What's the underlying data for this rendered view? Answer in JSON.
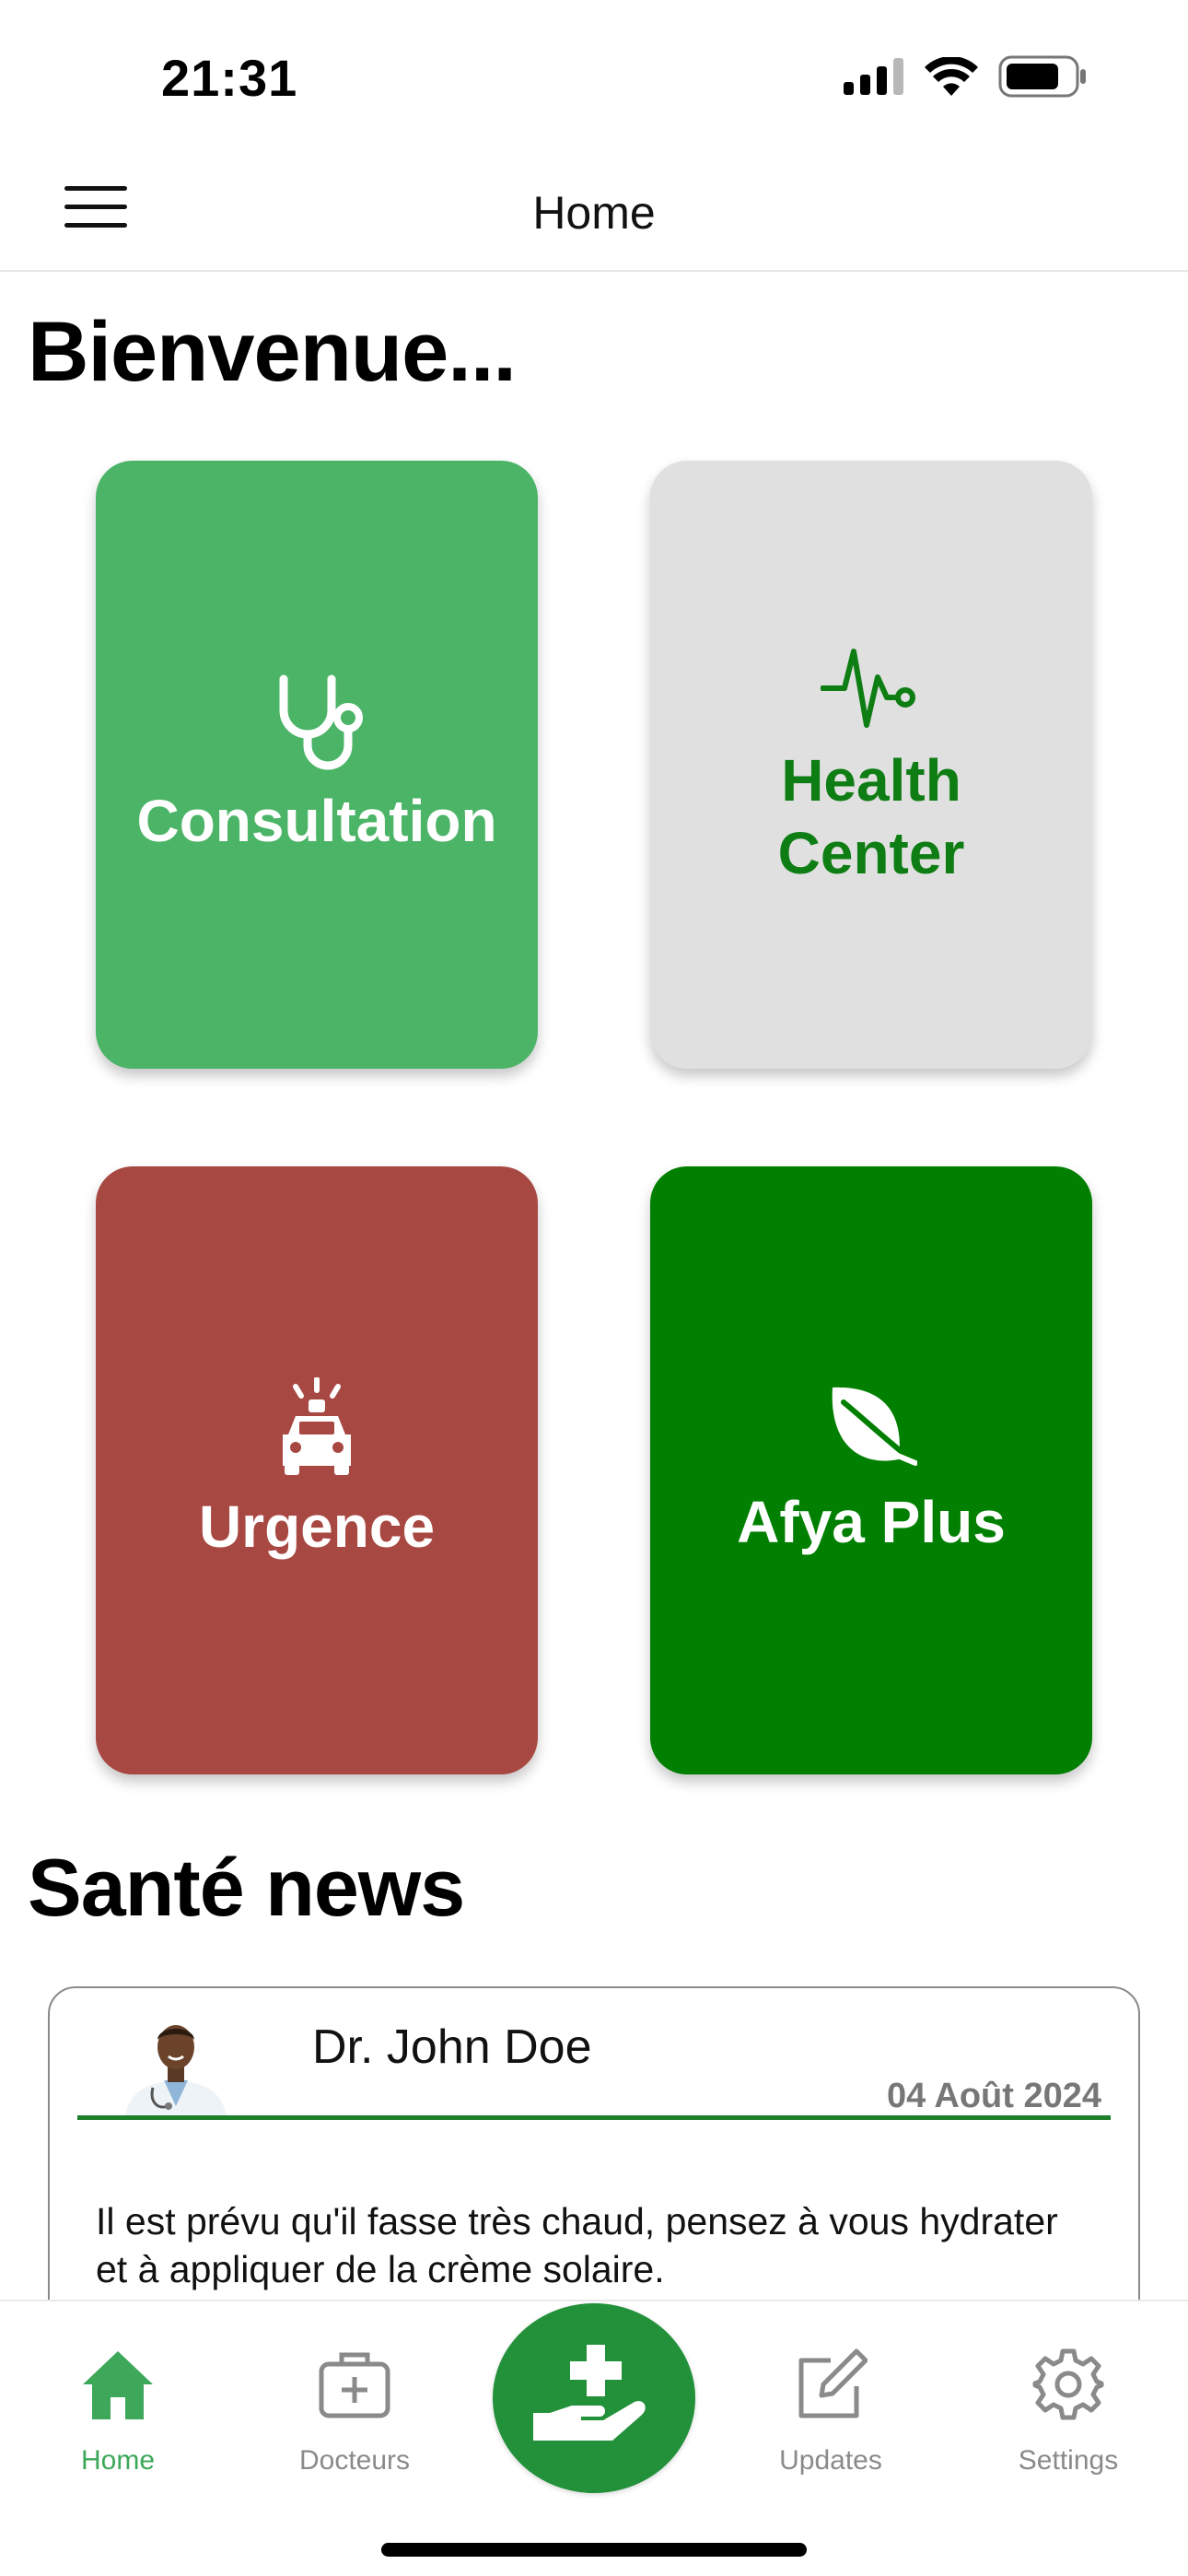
{
  "status_bar": {
    "time": "21:31"
  },
  "header": {
    "title": "Home"
  },
  "welcome": "Bienvenue...",
  "tiles": [
    {
      "label": "Consultation",
      "icon": "stethoscope-icon",
      "color": "#4bb467",
      "text_color": "#ffffff"
    },
    {
      "label": "Health Center",
      "icon": "heartbeat-pulse-icon",
      "color": "#e0e0e0",
      "text_color": "#0e7d13"
    },
    {
      "label": "Urgence",
      "icon": "ambulance-siren-icon",
      "color": "#a84842",
      "text_color": "#ffffff"
    },
    {
      "label": "Afya Plus",
      "icon": "leaf-icon",
      "color": "#007f00",
      "text_color": "#ffffff"
    }
  ],
  "news": {
    "heading": "Santé news",
    "items": [
      {
        "author": "Dr. John Doe",
        "date": "04 Août 2024",
        "text": "Il est prévu qu'il fasse très chaud, pensez à vous hydrater et à appliquer de la crème solaire."
      }
    ]
  },
  "tab_bar": {
    "tabs": [
      {
        "label": "Home",
        "icon": "home-icon",
        "active": true
      },
      {
        "label": "Docteurs",
        "icon": "medical-bag-icon",
        "active": false
      },
      {
        "label": "Updates",
        "icon": "edit-icon",
        "active": false
      },
      {
        "label": "Settings",
        "icon": "gear-icon",
        "active": false
      }
    ],
    "center_action_icon": "hand-plus-icon"
  },
  "colors": {
    "accent": "#22913a",
    "active_tab": "#3da85a",
    "inactive_tab": "#8a8a8a"
  }
}
